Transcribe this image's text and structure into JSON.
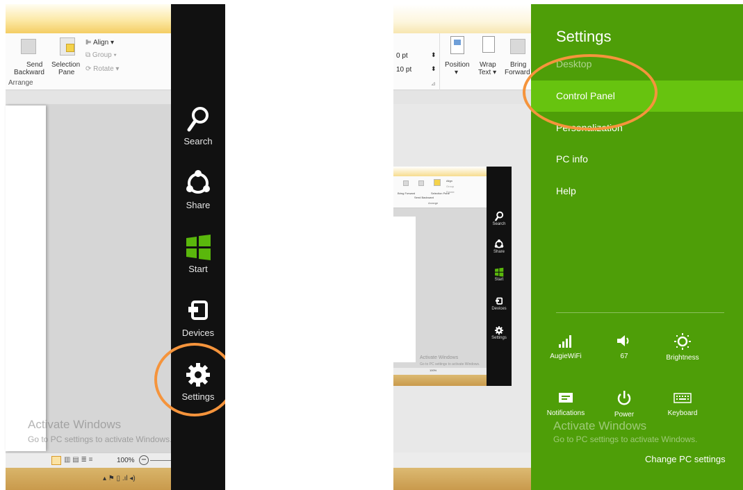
{
  "left": {
    "ribbon": {
      "send_backward": "Send",
      "send_backward_2": "Backward",
      "selection_pane": "Selection",
      "selection_pane_2": "Pane",
      "align": "Align",
      "group": "Group",
      "rotate": "Rotate",
      "section": "Arrange"
    },
    "charms": {
      "search": "Search",
      "share": "Share",
      "start": "Start",
      "devices": "Devices",
      "settings": "Settings"
    },
    "watermark": {
      "title": "Activate Windows",
      "subtitle": "Go to PC settings to activate Windows."
    },
    "status": {
      "zoom": "100%"
    }
  },
  "right": {
    "ribbon": {
      "spin1": "0 pt",
      "spin2": "10 pt",
      "position": "Position",
      "wrap_text": "Wrap",
      "wrap_text_2": "Text",
      "bring_forward": "Bring",
      "bring_forward_2": "Forward"
    },
    "thumbnail": {
      "bring_forward": "Bring",
      "bring_forward_2": "Forward",
      "send_backward": "Send",
      "send_backward_2": "Backward",
      "selection_pane": "Selection",
      "selection_pane_2": "Pane",
      "align": "Align",
      "group": "Group",
      "rotate": "Rotate",
      "section": "Arrange",
      "search": "Search",
      "share": "Share",
      "start": "Start",
      "devices": "Devices",
      "settings": "Settings",
      "watermark_title": "Activate Windows",
      "watermark_sub": "Go to PC settings to activate Windows.",
      "zoom": "100%"
    },
    "settings": {
      "title": "Settings",
      "items": [
        "Desktop",
        "Control Panel",
        "Personalization",
        "PC info",
        "Help"
      ],
      "quick": {
        "network": "AugieWiFi",
        "volume": "67",
        "brightness": "Brightness",
        "notifications": "Notifications",
        "power": "Power",
        "keyboard": "Keyboard"
      },
      "watermark_title": "Activate Windows",
      "watermark_sub": "Go to PC settings to activate Windows.",
      "change_pc_settings": "Change PC settings"
    }
  },
  "colors": {
    "settings_bg": "#4e9e08",
    "settings_selected": "#67c30f",
    "charms_bg": "#111111",
    "callout": "#f5943c",
    "start_green": "#5ab70c"
  }
}
